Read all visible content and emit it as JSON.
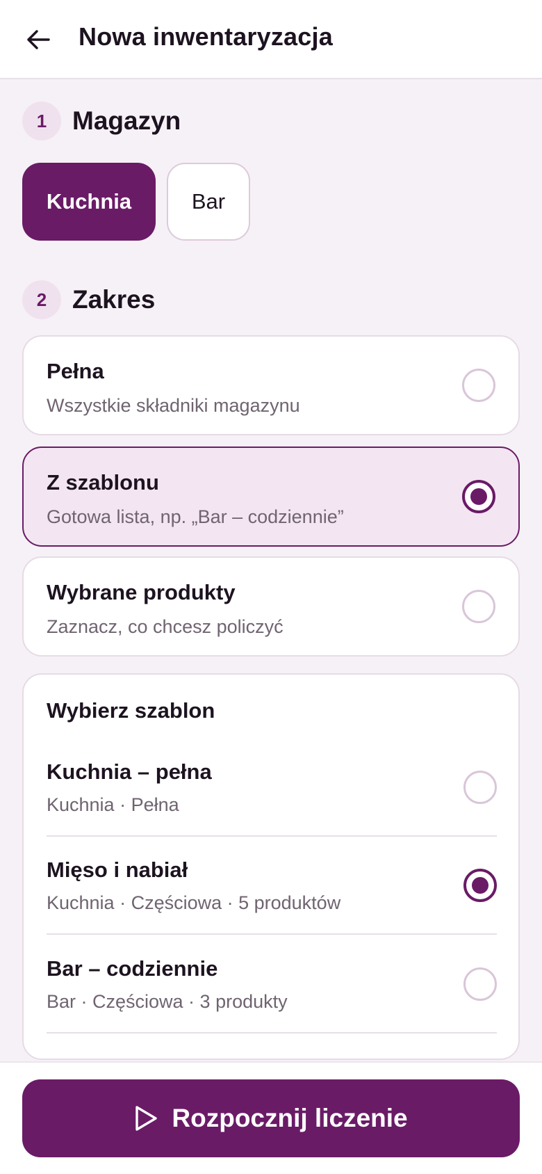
{
  "header": {
    "title": "Nowa inwentaryzacja",
    "back_icon": "arrow-left-icon"
  },
  "sections": {
    "warehouse": {
      "number": "1",
      "title": "Magazyn"
    },
    "scope": {
      "number": "2",
      "title": "Zakres"
    }
  },
  "warehouses": [
    {
      "label": "Kuchnia",
      "selected": true
    },
    {
      "label": "Bar",
      "selected": false
    }
  ],
  "scope_options": [
    {
      "title": "Pełna",
      "subtitle": "Wszystkie składniki magazynu",
      "selected": false
    },
    {
      "title": "Z szablonu",
      "subtitle": "Gotowa lista, np. „Bar – codziennie”",
      "selected": true
    },
    {
      "title": "Wybrane produkty",
      "subtitle": "Zaznacz, co chcesz policzyć",
      "selected": false
    }
  ],
  "templates": {
    "heading": "Wybierz szablon",
    "items": [
      {
        "name": "Kuchnia – pełna",
        "meta": "Kuchnia · Pełna",
        "selected": false
      },
      {
        "name": "Mięso i nabiał",
        "meta": "Kuchnia · Częściowa · 5 produktów",
        "selected": true
      },
      {
        "name": "Bar – codziennie",
        "meta": "Bar · Częściowa · 3 produkty",
        "selected": false
      }
    ]
  },
  "footer": {
    "start_label": "Rozpocznij liczenie",
    "start_icon": "play-icon"
  },
  "colors": {
    "accent": "#6a1b66",
    "accent_light": "#f3e6f2",
    "background": "#f6f1f6"
  }
}
